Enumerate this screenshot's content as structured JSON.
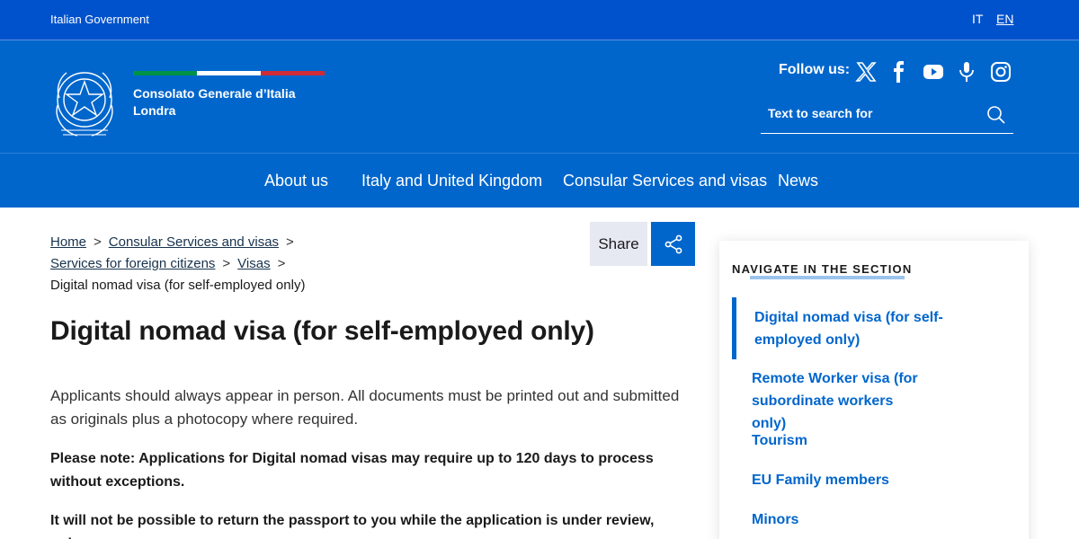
{
  "slim_header": {
    "government_label": "Italian Government",
    "languages": [
      "IT",
      "EN"
    ]
  },
  "header": {
    "brand_line1": "Consolato Generale d’Italia",
    "brand_line2": "Londra",
    "flag_colors": [
      "#009246",
      "#ffffff",
      "#ce2b37"
    ],
    "follow_label": "Follow us:",
    "social_icons": [
      "x-icon",
      "facebook-icon",
      "youtube-icon",
      "podcast-icon",
      "instagram-icon"
    ],
    "search_placeholder": "Text to search for"
  },
  "nav": {
    "items": [
      "About us",
      "Italy and United Kingdom",
      "Consular Services and visas",
      "News"
    ]
  },
  "breadcrumb": {
    "home": "Home",
    "level1": "Consular Services and visas",
    "level2": "Services for foreign citizens",
    "level3": "Visas",
    "current": "Digital nomad visa (for self-employed only)",
    "separator": ">"
  },
  "share": {
    "label": "Share"
  },
  "main": {
    "title": "Digital nomad visa (for self-employed only)",
    "paragraph1": "Applicants should always appear in person. All documents must be printed out and submitted as originals plus a photocopy where required.",
    "paragraph2": "Please note: Applications for Digital nomad visas may require up to 120 days to process without exceptions.",
    "paragraph3": "It will not be possible to return the passport to you while the application is under review, unless you"
  },
  "sidebar": {
    "title": "NAVIGATE IN THE SECTION",
    "items": [
      {
        "label": "Digital nomad visa (for self-employed only)"
      },
      {
        "label": "Remote Worker visa (for subordinate workers only)"
      },
      {
        "label": "Tourism"
      },
      {
        "label": "EU Family members"
      },
      {
        "label": "Minors"
      }
    ]
  },
  "colors": {
    "primary": "#0066cc",
    "slim_header": "#0052cc",
    "share_label_bg": "#e6e9f2"
  }
}
